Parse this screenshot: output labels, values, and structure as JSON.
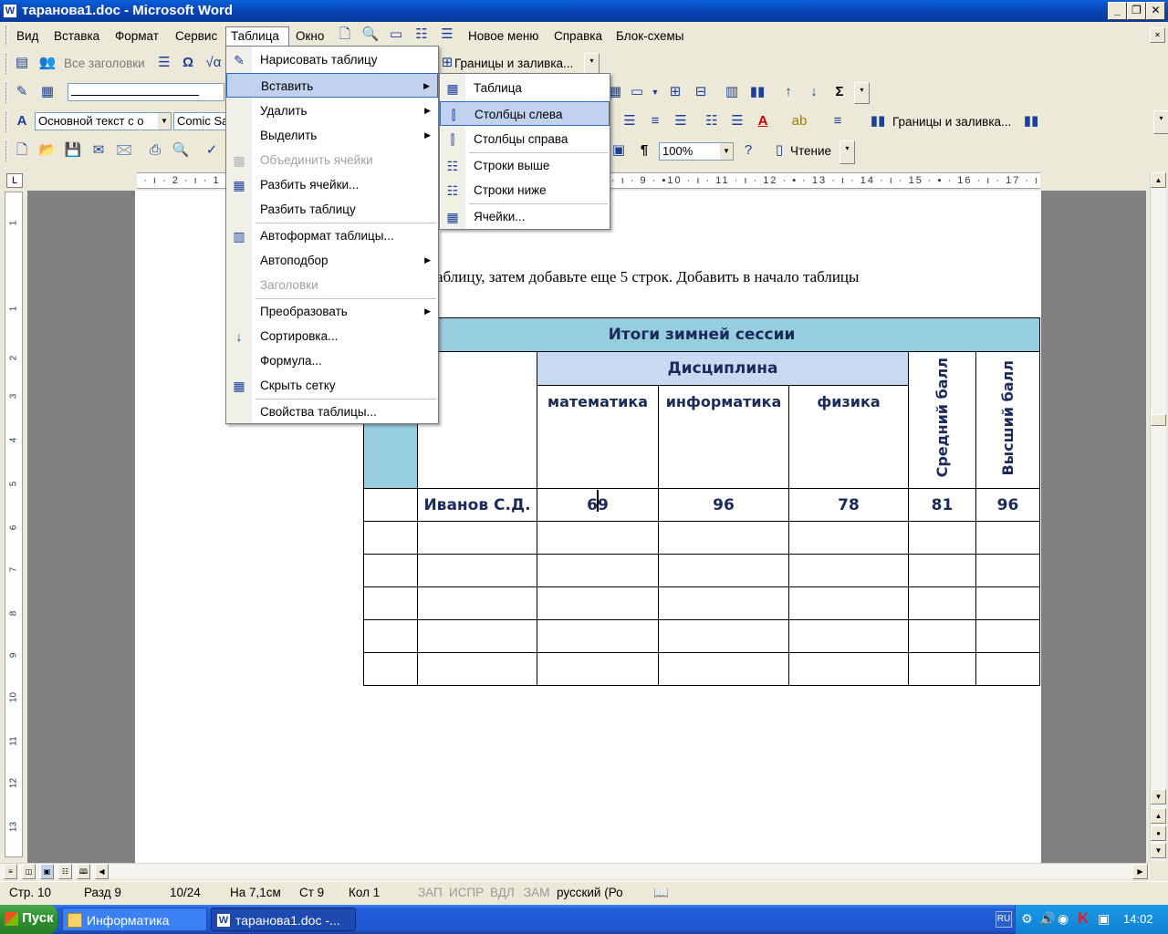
{
  "window": {
    "title": "таранова1.doc - Microsoft Word"
  },
  "menubar": [
    "Вид",
    "Вставка",
    "Формат",
    "Сервис",
    "Таблица",
    "Окно",
    "Новое меню",
    "Справка",
    "Блок-схемы"
  ],
  "toolbars": {
    "all_headings": "Все заголовки",
    "borders": "Границы и заливка...",
    "style": "Основной текст с о",
    "font": "Comic Sa",
    "zoom": "100%",
    "reading": "Чтение"
  },
  "ruler": {
    "top": "3 · ı · 2 · ı · 1",
    "top_right": "· ı · 9 · ▪10 · ı · 11 · ı · 12 · ▪ · 13 · ı · 14 · ı · 15 · ▪ · 16 · ı · 17 · ı ·",
    "left_marks": [
      "1",
      "1",
      "2",
      "3",
      "4",
      "5",
      "6",
      "7",
      "8",
      "9",
      "10",
      "11",
      "12",
      "13"
    ]
  },
  "table_menu": [
    "Нарисовать таблицу",
    "Вставить",
    "Удалить",
    "Выделить",
    "Объединить ячейки",
    "Разбить ячейки...",
    "Разбить таблицу",
    "Автоформат таблицы...",
    "Автоподбор",
    "Заголовки",
    "Преобразовать",
    "Сортировка...",
    "Формула...",
    "Скрыть сетку",
    "Свойства таблицы..."
  ],
  "insert_submenu": [
    "Таблица",
    "Столбцы слева",
    "Столбцы справа",
    "Строки выше",
    "Строки ниже",
    "Ячейки..."
  ],
  "document": {
    "text_fragment": "аблицу, затем добавьте еще 5 строк. Добавить в начало таблицы",
    "table": {
      "title": "Итоги зимней сессии",
      "discipline": "Дисциплина",
      "subjects": [
        "математика",
        "информатика",
        "физика"
      ],
      "avg": "Средний балл",
      "max": "Высший балл",
      "row1": [
        "Иванов С.Д.",
        "69",
        "96",
        "78",
        "81",
        "96"
      ]
    }
  },
  "statusbar": {
    "page": "Стр. 10",
    "section": "Разд 9",
    "pages": "10/24",
    "at": "На 7,1см",
    "line": "Ст 9",
    "col": "Кол 1",
    "rec": "ЗАП",
    "trk": "ИСПР",
    "ext": "ВДЛ",
    "ovr": "ЗАМ",
    "lang": "русский (Ро"
  },
  "taskbar": {
    "start": "Пуск",
    "tasks": [
      "Информатика",
      "таранова1.doc -..."
    ],
    "lang": "RU",
    "time": "14:02"
  }
}
